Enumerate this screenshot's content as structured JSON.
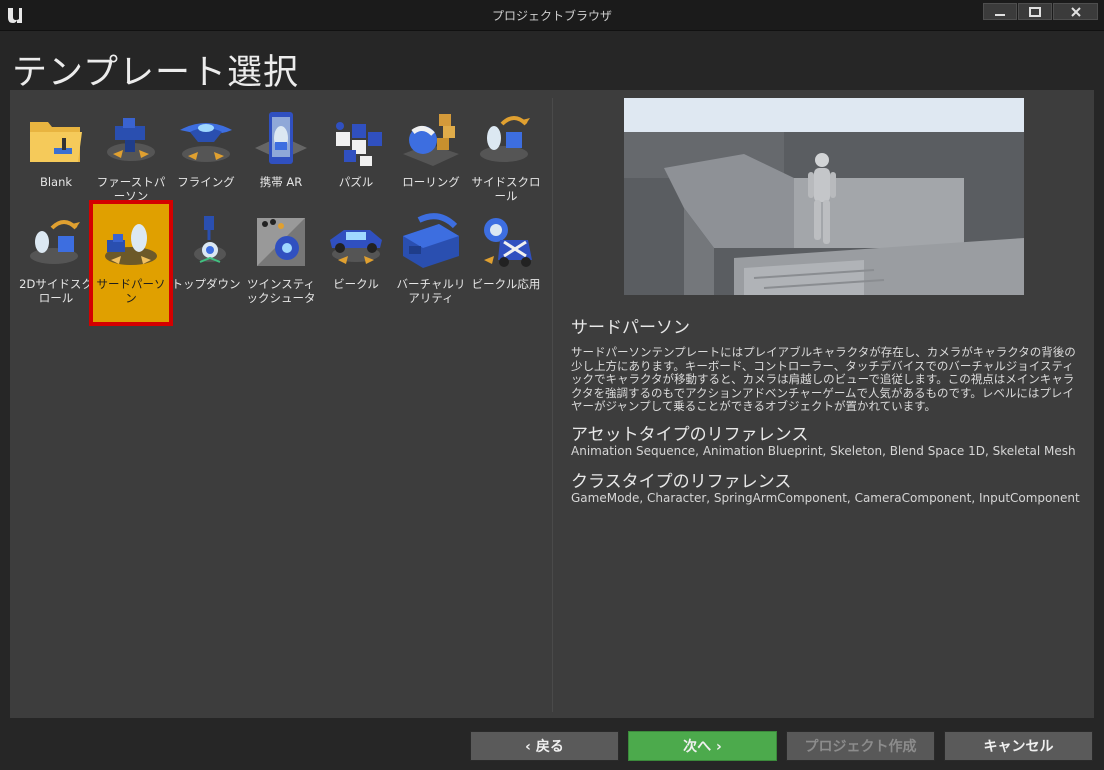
{
  "window": {
    "title": "プロジェクトブラウザ"
  },
  "page": {
    "title": "テンプレート選択"
  },
  "templates": [
    {
      "label": "Blank",
      "icon": "folder-icon"
    },
    {
      "label": "ファーストパーソン",
      "icon": "first-person-gun-icon"
    },
    {
      "label": "フライング",
      "icon": "flying-ship-icon"
    },
    {
      "label": "携帯 AR",
      "icon": "handheld-ar-phone-icon"
    },
    {
      "label": "パズル",
      "icon": "puzzle-blocks-icon"
    },
    {
      "label": "ローリング",
      "icon": "rolling-ball-icon"
    },
    {
      "label": "サイドスクロール",
      "icon": "side-scroller-icon"
    },
    {
      "label": "2Dサイドスクロール",
      "icon": "2d-side-scroller-icon"
    },
    {
      "label": "サードパーソン",
      "icon": "third-person-icon",
      "selected": true
    },
    {
      "label": "トップダウン",
      "icon": "top-down-icon"
    },
    {
      "label": "ツインスティックシュータ",
      "icon": "twin-stick-shooter-icon"
    },
    {
      "label": "ビークル",
      "icon": "vehicle-car-icon"
    },
    {
      "label": "バーチャルリアリティ",
      "icon": "vr-headset-icon"
    },
    {
      "label": "ビークル応用",
      "icon": "vehicle-advanced-icon"
    }
  ],
  "detail": {
    "title": "サードパーソン",
    "description": "サードパーソンテンプレートにはプレイアブルキャラクタが存在し、カメラがキャラクタの背後の少し上方にあります。キーボード、コントローラー、タッチデバイスでのバーチャルジョイスティックでキャラクタが移動すると、カメラは肩越しのビューで追従します。この視点はメインキャラクタを強調するのもでアクションアドベンチャーゲームで人気があるものです。レベルにはプレイヤーがジャンプして乗ることができるオブジェクトが置かれています。",
    "asset_heading": "アセットタイプのリファレンス",
    "asset_list": "Animation Sequence, Animation Blueprint, Skeleton, Blend Space 1D, Skeletal Mesh",
    "class_heading": "クラスタイプのリファレンス",
    "class_list": "GameMode, Character, SpringArmComponent, CameraComponent, InputComponent"
  },
  "buttons": {
    "back": "‹ 戻る",
    "next": "次へ ›",
    "create": "プロジェクト作成",
    "cancel": "キャンセル"
  },
  "colors": {
    "selected_tile": "#e0a000",
    "selected_outline": "#d40000",
    "next_button": "#4caa4c"
  }
}
